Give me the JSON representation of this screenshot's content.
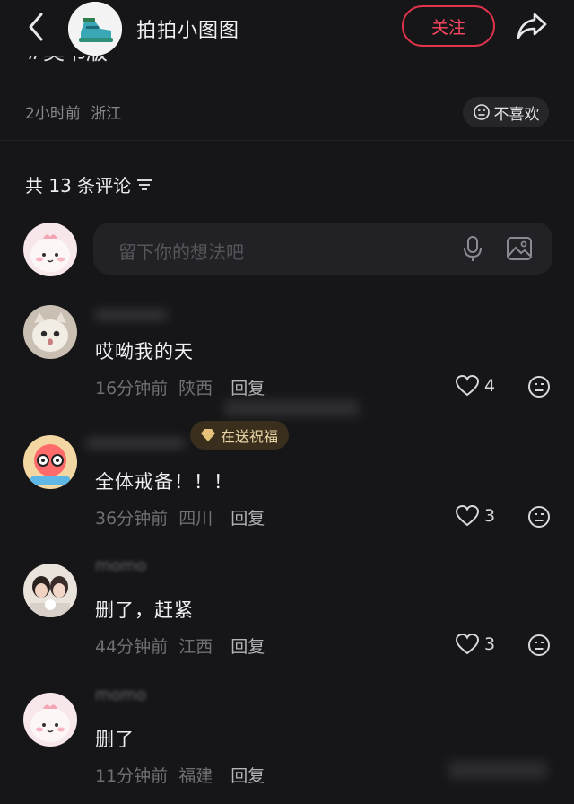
{
  "header": {
    "username": "拍拍小图图",
    "follow_label": "关注"
  },
  "post": {
    "partial_text": "#奥书版",
    "time": "2小时前",
    "location": "浙江",
    "dislike_label": "不喜欢"
  },
  "comments_section": {
    "count_label": "共 13 条评论",
    "input_placeholder": "留下你的想法吧"
  },
  "comments": [
    {
      "text": "哎呦我的天",
      "time": "16分钟前",
      "location": "陕西",
      "reply_label": "回复",
      "likes": "4"
    },
    {
      "text": "全体戒备！！！",
      "time": "36分钟前",
      "location": "四川",
      "reply_label": "回复",
      "likes": "3",
      "badge": "在送祝福"
    },
    {
      "name": "momo",
      "text": "删了，赶紧",
      "time": "44分钟前",
      "location": "江西",
      "reply_label": "回复",
      "likes": "3"
    },
    {
      "name": "momo",
      "text": "删了",
      "time": "11分钟前",
      "location": "福建",
      "reply_label": "回复"
    }
  ],
  "colors": {
    "background": "#161618",
    "accent": "#ff4863",
    "muted_text": "#6f6f75",
    "input_bg": "#222226"
  },
  "icons": [
    "back-arrow-icon",
    "share-icon",
    "dislike-face-icon",
    "sort-filter-icon",
    "mic-icon",
    "image-icon",
    "heart-icon",
    "emoji-face-icon",
    "gift-heart-icon"
  ]
}
